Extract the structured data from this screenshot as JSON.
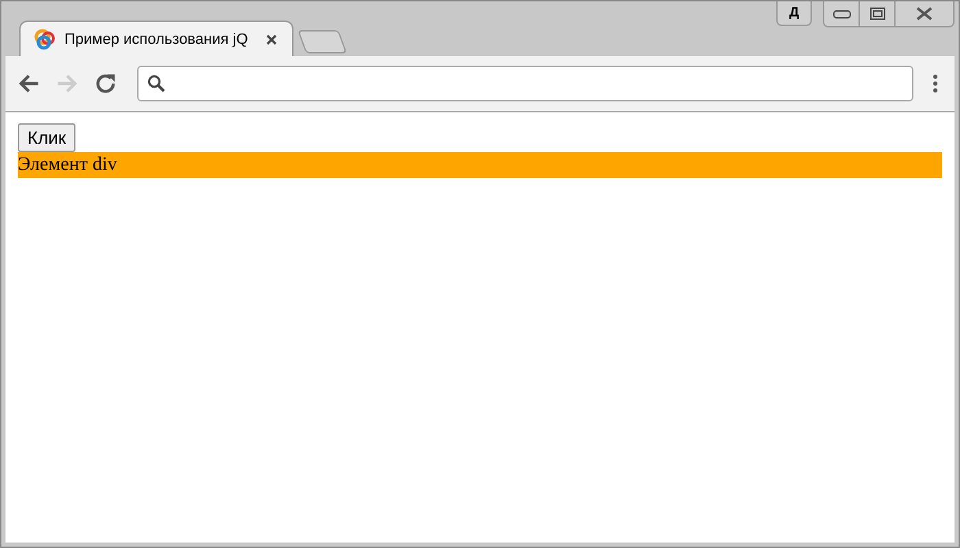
{
  "window": {
    "profile_button": "Д"
  },
  "tabs": [
    {
      "title": "Пример использования jQ",
      "selected": true
    }
  ],
  "page": {
    "button": "Клик",
    "div_text": "Элемент div"
  }
}
